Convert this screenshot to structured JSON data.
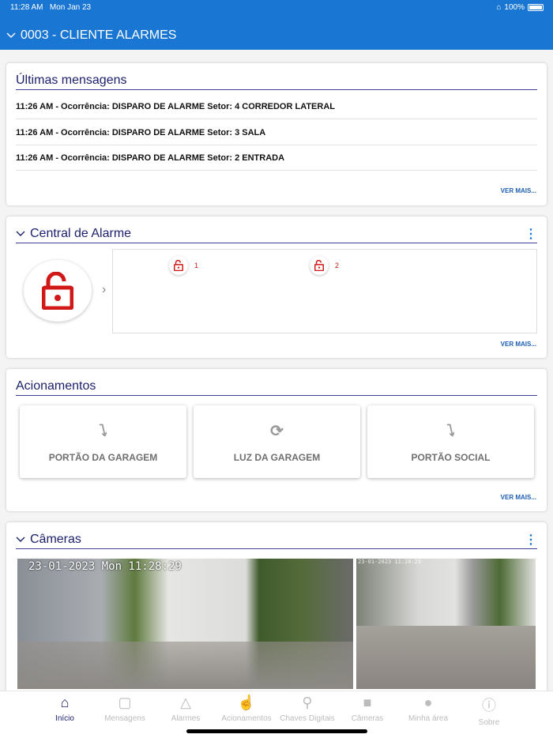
{
  "status": {
    "time": "11:28 AM",
    "date": "Mon Jan 23",
    "battery": "100%"
  },
  "header": {
    "title": "0003 - CLIENTE ALARMES"
  },
  "messages": {
    "title": "Últimas mensagens",
    "items": [
      "11:26 AM - Ocorrência: DISPARO DE ALARME Setor: 4 CORREDOR LATERAL",
      "11:26 AM - Ocorrência: DISPARO DE ALARME Setor: 3 SALA",
      "11:26 AM - Ocorrência: DISPARO DE ALARME Setor: 2 ENTRADA"
    ],
    "more": "VER MAIS..."
  },
  "alarm": {
    "title": "Central de Alarme",
    "status_color": "#d01818",
    "zones": [
      {
        "label": "1"
      },
      {
        "label": "2"
      }
    ],
    "more": "VER MAIS..."
  },
  "actions": {
    "title": "Acionamentos",
    "items": [
      {
        "label": "PORTÃO DA GARAGEM",
        "icon": "bolt-icon"
      },
      {
        "label": "LUZ DA GARAGEM",
        "icon": "refresh-icon"
      },
      {
        "label": "PORTÃO SOCIAL",
        "icon": "bolt-icon"
      }
    ],
    "more": "VER MAIS..."
  },
  "cameras": {
    "title": "Câmeras",
    "feeds": [
      {
        "timestamp": "23-01-2023 Mon 11:28:29"
      },
      {
        "timestamp": "23-01-2023 11:28:29"
      }
    ]
  },
  "tabs": [
    {
      "label": "Início",
      "active": true
    },
    {
      "label": "Mensagens"
    },
    {
      "label": "Alarmes"
    },
    {
      "label": "Acionamentos"
    },
    {
      "label": "Chaves Digitais"
    },
    {
      "label": "Câmeras"
    },
    {
      "label": "Minha área"
    },
    {
      "label": "Sobre"
    }
  ],
  "colors": {
    "brand": "#1976d2",
    "accent": "#1b1f6b",
    "alert": "#d01818"
  }
}
